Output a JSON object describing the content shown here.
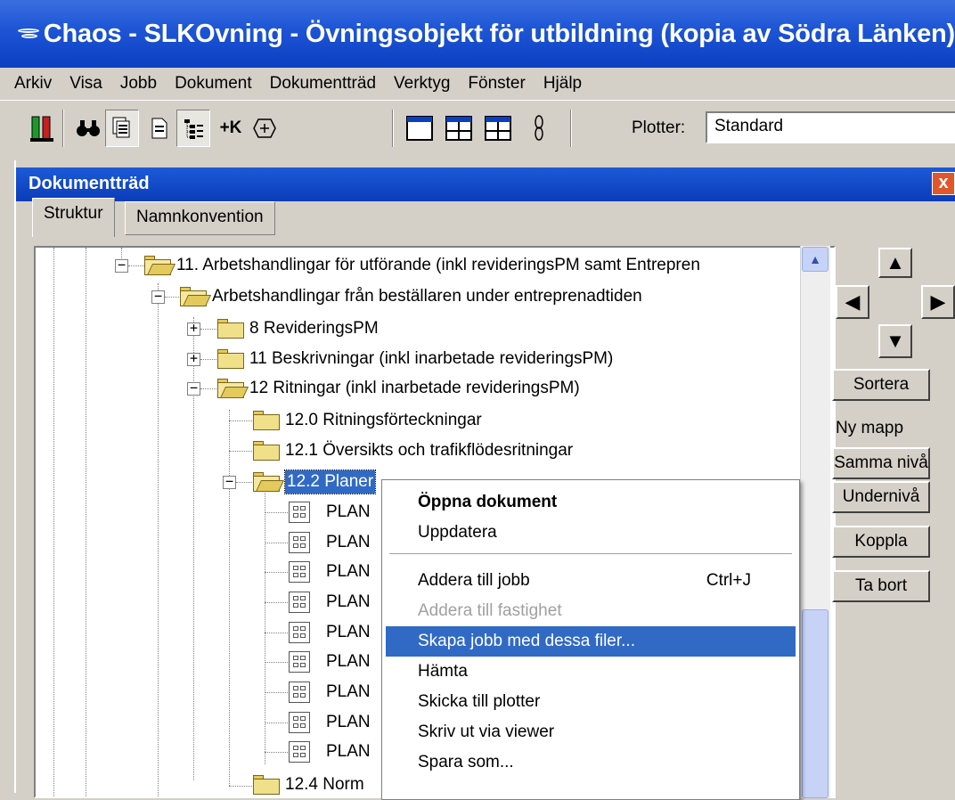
{
  "window": {
    "title": "Chaos - SLKOvning - Övningsobjekt för utbildning (kopia av Södra Länken)"
  },
  "menubar": [
    "Arkiv",
    "Visa",
    "Jobb",
    "Dokument",
    "Dokumentträd",
    "Verktyg",
    "Fönster",
    "Hjälp"
  ],
  "toolbar": {
    "plotter_label": "Plotter:",
    "plotter_value": "Standard",
    "add_k_label": "+K"
  },
  "panel": {
    "title": "Dokumentträd",
    "close_glyph": "x",
    "tabs": [
      "Struktur",
      "Namnkonvention"
    ]
  },
  "tree": {
    "nodes": [
      "11. Arbetshandlingar för utförande (inkl revideringsPM samt Entrepren",
      "Arbetshandlingar från beställaren under entreprenadtiden",
      "8 RevideringsPM",
      "11 Beskrivningar (inkl inarbetade revideringsPM)",
      "12 Ritningar (inkl inarbetade revideringsPM)",
      "12.0 Ritningsförteckningar",
      "12.1 Översikts och trafikflödesritningar",
      "12.2 Planer",
      "12.4 Norm"
    ],
    "doc_label": "PLAN",
    "doc_count": 9,
    "expander_plus": "+",
    "expander_minus": "−"
  },
  "side_panel": {
    "up": "▲",
    "left": "◀",
    "right": "▶",
    "down": "▼",
    "sort": "Sortera",
    "new_folder_label": "Ny mapp",
    "same_level": "Samma nivå",
    "sub_level": "Undernivå",
    "link": "Koppla",
    "remove": "Ta bort"
  },
  "context_menu": {
    "open": "Öppna dokument",
    "update": "Uppdatera",
    "add_to_job": "Addera till jobb",
    "add_to_job_shortcut": "Ctrl+J",
    "add_to_property": "Addera till fastighet",
    "create_job": "Skapa jobb med dessa filer...",
    "fetch": "Hämta",
    "send_to_plotter": "Skicka till plotter",
    "print_via_viewer": "Skriv ut via viewer",
    "save_as": "Spara som..."
  },
  "colors": {
    "titlebar": "#0a3fc2",
    "selection": "#316ac5",
    "folder": "#f1e08a"
  }
}
